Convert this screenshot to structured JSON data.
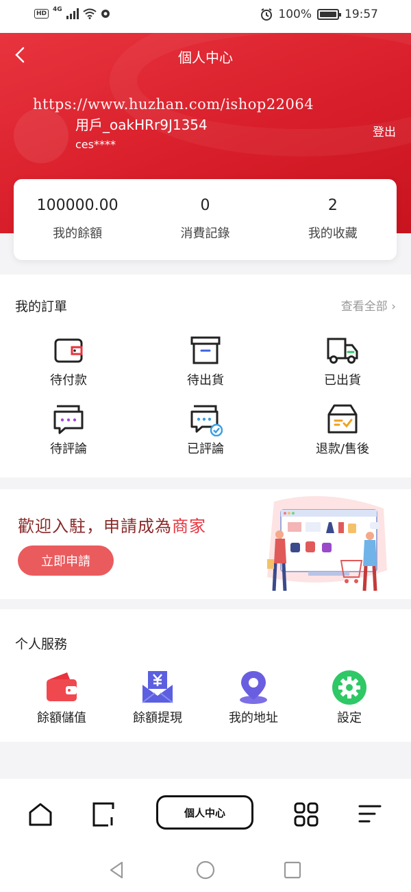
{
  "status_bar": {
    "network": "4G",
    "battery": "100%",
    "time": "19:57",
    "hd": "HD"
  },
  "header": {
    "title": "個人中心",
    "watermark": "https://www.huzhan.com/ishop22064",
    "username": "用戶_oakHRr9J1354",
    "account": "ces****",
    "logout": "登出"
  },
  "stats": [
    {
      "value": "100000.00",
      "label": "我的餘額"
    },
    {
      "value": "0",
      "label": "消費記錄"
    },
    {
      "value": "2",
      "label": "我的收藏"
    }
  ],
  "orders": {
    "title": "我的訂單",
    "view_all": "查看全部 ›",
    "items": [
      {
        "label": "待付款",
        "icon": "wallet-icon"
      },
      {
        "label": "待出貨",
        "icon": "box-icon"
      },
      {
        "label": "已出貨",
        "icon": "truck-icon"
      },
      {
        "label": "待評論",
        "icon": "chat-icon"
      },
      {
        "label": "已評論",
        "icon": "chat-check-icon"
      },
      {
        "label": "退款/售後",
        "icon": "refund-box-icon"
      }
    ]
  },
  "merchant": {
    "headline_prefix": "歡迎入駐，申請成為",
    "headline_emphasis": "商家",
    "apply_label": "立即申請"
  },
  "services": {
    "title": "个人服務",
    "items": [
      {
        "label": "餘額儲值",
        "icon": "wallet-red-icon"
      },
      {
        "label": "餘額提現",
        "icon": "yen-envelope-icon"
      },
      {
        "label": "我的地址",
        "icon": "location-pin-icon"
      },
      {
        "label": "設定",
        "icon": "gear-icon"
      }
    ]
  },
  "bottom_nav": {
    "center_label": "個人中心",
    "items": [
      "home-icon",
      "tablet-icon",
      "grid-icon",
      "menu-icon"
    ]
  },
  "colors": {
    "brand_red": "#e8343e",
    "apply_button": "#ea5b5e",
    "service_purple": "#5b5fe0",
    "service_green": "#2ec866"
  }
}
